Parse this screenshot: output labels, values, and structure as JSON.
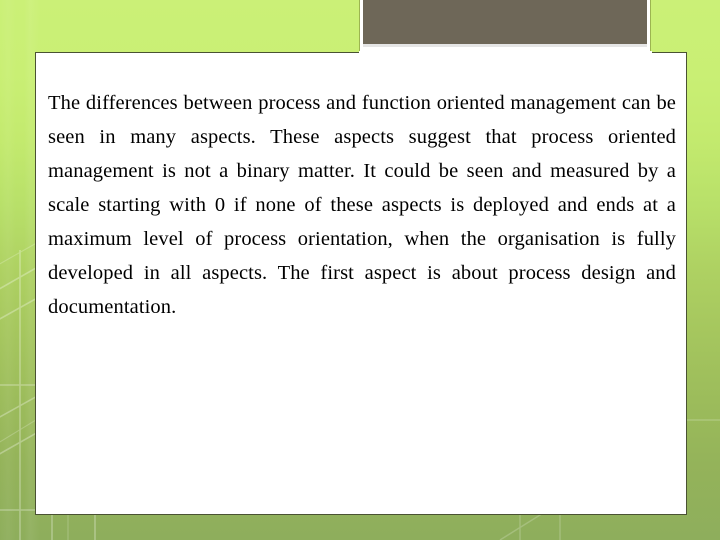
{
  "slide": {
    "body_text": "The differences between process and function oriented management can be seen in many aspects. These aspects suggest that process oriented management is not a binary matter. It could be seen and measured by a scale starting with 0 if none of these aspects is deployed and ends at a maximum level of process orientation, when the organisation is fully developed in all aspects. The first aspect is about process design and documentation.",
    "colors": {
      "background_top": "#CBF077",
      "background_bottom": "#8EAE5C",
      "accent_box": "#6E6758",
      "accent_border": "#9CB550",
      "card_border": "#4A5233",
      "card_background": "#FFFFFF",
      "text": "#000000"
    }
  }
}
